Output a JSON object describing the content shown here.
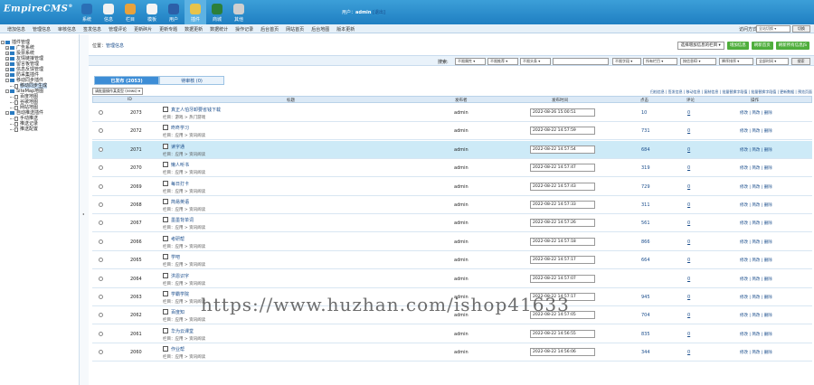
{
  "app": {
    "logo": "EmpireCMS",
    "logo_mark": "®",
    "user_prefix": "用户：",
    "user_name": "admin",
    "logout": "[退出]"
  },
  "top_nav": [
    {
      "label": "系统",
      "icon": "globe-icon",
      "color": "#2a6fb6"
    },
    {
      "label": "信息",
      "icon": "document-icon",
      "color": "#f1f1f1"
    },
    {
      "label": "栏目",
      "icon": "folder-icon",
      "color": "#e9a23b"
    },
    {
      "label": "模板",
      "icon": "template-icon",
      "color": "#f4f4f4"
    },
    {
      "label": "用户",
      "icon": "user-icon",
      "color": "#2c5fa8"
    },
    {
      "label": "插件",
      "icon": "pen-icon",
      "color": "#e8c34a"
    },
    {
      "label": "商城",
      "icon": "chart-icon",
      "color": "#2c7f3a"
    },
    {
      "label": "其他",
      "icon": "gear-icon",
      "color": "#cfcfcf"
    }
  ],
  "sub_nav": [
    "增加信息",
    "管理信息",
    "审核信息",
    "签发信息",
    "管理评论",
    "更新碎片",
    "更新专题",
    "数据更新",
    "数据统计",
    "操作记录",
    "后台首页",
    "网站首页",
    "后台地图",
    "版本更新"
  ],
  "view_label": "访问方式：",
  "view_select": "全站切换",
  "view_button": "切换",
  "sidebar": [
    {
      "label": "插件管理",
      "level": 0,
      "type": "folder",
      "toggle": "-"
    },
    {
      "label": "广告系统",
      "level": 1,
      "type": "folder",
      "toggle": "+"
    },
    {
      "label": "投票系统",
      "level": 1,
      "type": "folder",
      "toggle": "+"
    },
    {
      "label": "友情链接管理",
      "level": 1,
      "type": "folder",
      "toggle": "+"
    },
    {
      "label": "留言板管理",
      "level": 1,
      "type": "folder",
      "toggle": "+"
    },
    {
      "label": "信息反馈管理",
      "level": 1,
      "type": "folder",
      "toggle": "+"
    },
    {
      "label": "防采集插件",
      "level": 1,
      "type": "folder",
      "toggle": "+"
    },
    {
      "label": "移动同步插件",
      "level": 1,
      "type": "folder",
      "toggle": "-"
    },
    {
      "label": "移动同步生成",
      "level": 2,
      "type": "page",
      "toggle": ""
    },
    {
      "label": "SiteMap地图",
      "level": 1,
      "type": "folder",
      "toggle": "-"
    },
    {
      "label": "百度地图",
      "level": 2,
      "type": "page",
      "toggle": ""
    },
    {
      "label": "谷歌地图",
      "level": 2,
      "type": "page",
      "toggle": ""
    },
    {
      "label": "网站地图",
      "level": 2,
      "type": "page",
      "toggle": ""
    },
    {
      "label": "自动推送插件",
      "level": 1,
      "type": "folder",
      "toggle": "-"
    },
    {
      "label": "手动推送",
      "level": 2,
      "type": "page",
      "toggle": ""
    },
    {
      "label": "推送记录",
      "level": 2,
      "type": "page",
      "toggle": ""
    },
    {
      "label": "推送配置",
      "level": 2,
      "type": "page",
      "toggle": ""
    }
  ],
  "position": {
    "label": "位置：",
    "link": "管理信息"
  },
  "top_buttons": {
    "select": "选择增加信息的栏目",
    "b1": "增加信息",
    "b2": "刷新首页",
    "b3": "刷新所有信息JS"
  },
  "search": {
    "label": "搜索:",
    "fields": [
      "不限属性",
      "不限推荐",
      "不限头条",
      "",
      "不限字段",
      "所有栏目",
      "按信息ID",
      "降序排序",
      "全部时间"
    ],
    "button": "搜索"
  },
  "tabs": {
    "published": "已发布 (2053)",
    "pending": "待审核 (0)"
  },
  "batch_select": "请批量操作某类型 (news)",
  "action_links": "归档信息 | 签发信息 | 移动信息 | 复制信息 | 批量替换字段值 | 批量替换字段值 | 更新数据 | 预览页面",
  "table": {
    "headers": {
      "id": "ID",
      "title": "标题",
      "publisher": "发布者",
      "time": "发布时间",
      "views": "点击",
      "comments": "评论",
      "ops": "操作"
    },
    "rows": [
      {
        "id": "2073",
        "title": "真正人怕牙卸要省钱下载",
        "column": "栏目：游戏 > 热门游戏",
        "publisher": "admin",
        "time": "2022-08-26 15:00:51",
        "views": "10",
        "comments": "0",
        "ops": "修改 | 简改 | 删除"
      },
      {
        "id": "2072",
        "title": "咚咚学习",
        "column": "栏目：应用 > 资讯阅读",
        "publisher": "admin",
        "time": "2022-08-22 14:57:59",
        "views": "731",
        "comments": "0",
        "ops": "修改 | 简改 | 删除"
      },
      {
        "id": "2071",
        "title": "读字通",
        "column": "栏目：应用 > 资讯阅读",
        "publisher": "admin",
        "time": "2022-08-22 14:57:54",
        "views": "684",
        "comments": "0",
        "ops": "修改 | 简改 | 删除"
      },
      {
        "id": "2070",
        "title": "懒人听书",
        "column": "栏目：应用 > 资讯阅读",
        "publisher": "admin",
        "time": "2022-08-22 14:57:47",
        "views": "319",
        "comments": "0",
        "ops": "修改 | 简改 | 删除"
      },
      {
        "id": "2069",
        "title": "每日打卡",
        "column": "栏目：应用 > 资讯阅读",
        "publisher": "admin",
        "time": "2022-08-22 14:57:43",
        "views": "729",
        "comments": "0",
        "ops": "修改 | 简改 | 删除"
      },
      {
        "id": "2068",
        "title": "简易英语",
        "column": "栏目：应用 > 资讯阅读",
        "publisher": "admin",
        "time": "2022-08-22 14:57:33",
        "views": "311",
        "comments": "0",
        "ops": "修改 | 简改 | 删除"
      },
      {
        "id": "2067",
        "title": "墨墨背单词",
        "column": "栏目：应用 > 资讯阅读",
        "publisher": "admin",
        "time": "2022-08-22 14:57:26",
        "views": "561",
        "comments": "0",
        "ops": "修改 | 简改 | 删除"
      },
      {
        "id": "2066",
        "title": "考研帮",
        "column": "栏目：应用 > 资讯阅读",
        "publisher": "admin",
        "time": "2022-08-22 14:57:18",
        "views": "866",
        "comments": "0",
        "ops": "修改 | 简改 | 删除"
      },
      {
        "id": "2065",
        "title": "学吧",
        "column": "栏目：应用 > 资讯阅读",
        "publisher": "admin",
        "time": "2022-08-22 14:57:17",
        "views": "664",
        "comments": "0",
        "ops": "修改 | 简改 | 删除"
      },
      {
        "id": "2064",
        "title": "洪恩识字",
        "column": "栏目：应用 > 资讯阅读",
        "publisher": "admin",
        "time": "2022-08-22 14:57:07",
        "views": "",
        "comments": "0",
        "ops": "修改 | 简改 | 删除"
      },
      {
        "id": "2063",
        "title": "学霸学院",
        "column": "栏目：应用 > 资讯阅读",
        "publisher": "admin",
        "time": "2022-08-22 14:57:17",
        "views": "945",
        "comments": "0",
        "ops": "修改 | 简改 | 删除"
      },
      {
        "id": "2062",
        "title": "百度知",
        "column": "栏目：应用 > 资讯阅读",
        "publisher": "admin",
        "time": "2022-08-22 14:57:05",
        "views": "704",
        "comments": "0",
        "ops": "修改 | 简改 | 删除"
      },
      {
        "id": "2061",
        "title": "华为云课堂",
        "column": "栏目：应用 > 资讯阅读",
        "publisher": "admin",
        "time": "2022-08-22 14:56:55",
        "views": "835",
        "comments": "0",
        "ops": "修改 | 简改 | 删除"
      },
      {
        "id": "2060",
        "title": "作业帮",
        "column": "栏目：应用 > 资讯阅读",
        "publisher": "admin",
        "time": "2022-08-22 14:56:06",
        "views": "344",
        "comments": "0",
        "ops": "修改 | 简改 | 删除"
      }
    ]
  },
  "watermark": "https://www.huzhan.com/ishop41633",
  "colors": {
    "topbar": "#2a8dd0",
    "accent": "#3d8dd6",
    "green_button": "#4fae3c",
    "highlight_row": "#cdeaf7"
  }
}
